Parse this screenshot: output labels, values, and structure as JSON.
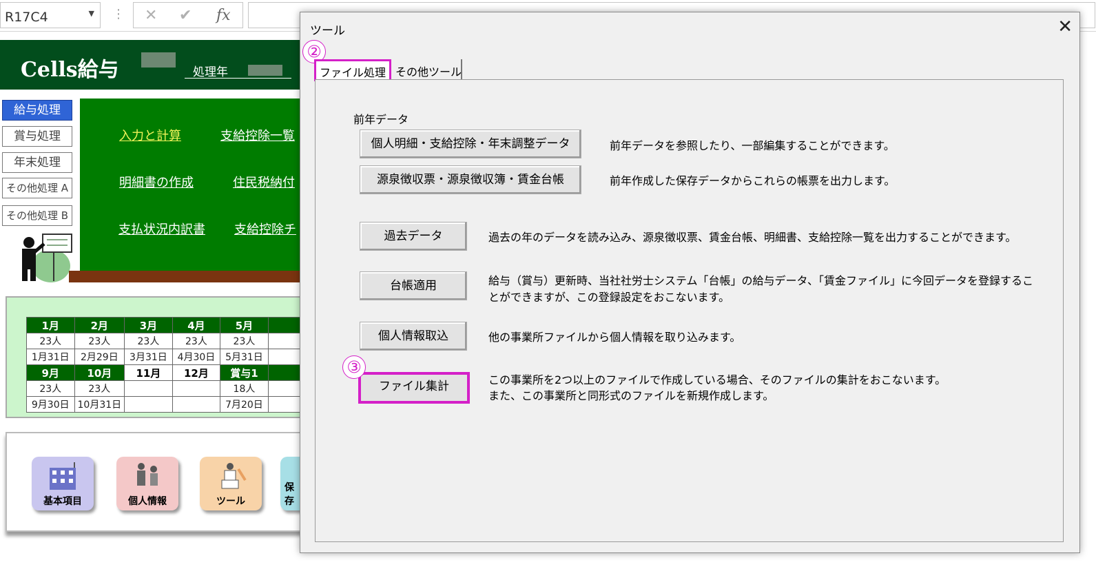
{
  "formula_bar": {
    "name_box": "R17C4",
    "cancel_icon": "✕",
    "enter_icon": "✔",
    "fx_icon": "fx"
  },
  "sheet": {
    "app_title": "Cells給与",
    "year_label": "処理年",
    "side_menu": [
      "給与処理",
      "賞与処理",
      "年末処理",
      "その他処理 A",
      "その他処理 B"
    ],
    "board_links": [
      "入力と計算",
      "支給控除一覧",
      "明細書の作成",
      "住民税納付",
      "支払状況内訳書",
      "支給控除チ"
    ],
    "calendar": {
      "row1_months": [
        "1月",
        "2月",
        "3月",
        "4月",
        "5月"
      ],
      "row1_counts": [
        "23人",
        "23人",
        "23人",
        "23人",
        "23人"
      ],
      "row1_dates": [
        "1月31日",
        "2月29日",
        "3月31日",
        "4月30日",
        "5月31日"
      ],
      "row2_months": [
        "9月",
        "10月",
        "11月",
        "12月",
        "賞与1"
      ],
      "row2_counts": [
        "23人",
        "23人",
        "",
        "",
        "18人"
      ],
      "row2_dates": [
        "9月30日",
        "10月31日",
        "",
        "",
        "7月20日"
      ]
    },
    "icon_buttons": [
      "基本項目",
      "個人情報",
      "ツール",
      "保存"
    ]
  },
  "dialog": {
    "title": "ツール",
    "close_icon": "✕",
    "tabs": [
      "ファイル処理",
      "その他ツール"
    ],
    "section_prev_year": "前年データ",
    "items": [
      {
        "button": "個人明細・支給控除・年末調整データ",
        "desc": [
          "前年データを参照したり、一部編集することができます。"
        ]
      },
      {
        "button": "源泉徴収票・源泉徴収簿・賃金台帳",
        "desc": [
          "前年作成した保存データからこれらの帳票を出力します。"
        ]
      },
      {
        "button": "過去データ",
        "desc": [
          "過去の年のデータを読み込み、源泉徴収票、賃金台帳、明細書、支給控除一覧を出力することができます。"
        ]
      },
      {
        "button": "台帳適用",
        "desc": [
          "給与（賞与）更新時、当社社労士システム「台帳」の給与データ、「賃金ファイル」に今回データを登録するこ",
          "とができますが、この登録設定をおこないます。"
        ]
      },
      {
        "button": "個人情報取込",
        "desc": [
          "他の事業所ファイルから個人情報を取り込みます。"
        ]
      },
      {
        "button": "ファイル集計",
        "desc": [
          "この事業所を2つ以上のファイルで作成している場合、そのファイルの集計をおこないます。",
          "また、この事業所と同形式のファイルを新規作成します。"
        ]
      }
    ],
    "marker_2": "②",
    "marker_3": "③"
  },
  "colors": {
    "highlight": "#d420c8",
    "banner": "#024d1c",
    "board": "#007c00",
    "active_menu": "#2f64d6"
  }
}
